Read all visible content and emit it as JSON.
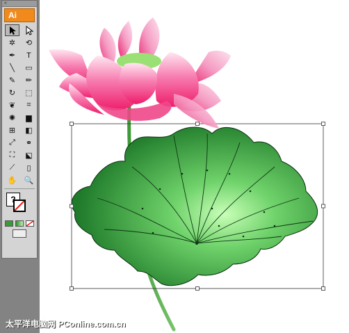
{
  "toolbox": {
    "grip": "«",
    "logo": "Ai",
    "tools": [
      {
        "name": "selection-tool",
        "glyph": "selection"
      },
      {
        "name": "direct-selection-tool",
        "glyph": "direct"
      },
      {
        "name": "magic-wand-tool",
        "glyph": "✲"
      },
      {
        "name": "lasso-tool",
        "glyph": "⟲"
      },
      {
        "name": "pen-tool",
        "glyph": "✒"
      },
      {
        "name": "type-tool",
        "glyph": "T"
      },
      {
        "name": "line-segment-tool",
        "glyph": "╲"
      },
      {
        "name": "rectangle-tool",
        "glyph": "▭"
      },
      {
        "name": "paintbrush-tool",
        "glyph": "✎"
      },
      {
        "name": "pencil-tool",
        "glyph": "✏"
      },
      {
        "name": "rotate-tool",
        "glyph": "↻"
      },
      {
        "name": "scale-tool",
        "glyph": "⬚"
      },
      {
        "name": "warp-tool",
        "glyph": "❦"
      },
      {
        "name": "free-transform-tool",
        "glyph": "⌗"
      },
      {
        "name": "symbol-sprayer-tool",
        "glyph": "✺"
      },
      {
        "name": "column-graph-tool",
        "glyph": "▆"
      },
      {
        "name": "mesh-tool",
        "glyph": "⊞"
      },
      {
        "name": "gradient-tool",
        "glyph": "◧"
      },
      {
        "name": "eyedropper-tool",
        "glyph": "⤢"
      },
      {
        "name": "blend-tool",
        "glyph": "⚭"
      },
      {
        "name": "live-paint-bucket-tool",
        "glyph": "⛶"
      },
      {
        "name": "live-paint-selection-tool",
        "glyph": "⬕"
      },
      {
        "name": "slice-tool",
        "glyph": "⟋"
      },
      {
        "name": "eraser-tool",
        "glyph": "▯"
      },
      {
        "name": "hand-tool",
        "glyph": "✋"
      },
      {
        "name": "zoom-tool",
        "glyph": "🔍"
      }
    ],
    "fill_label": "?",
    "colors": {
      "toolbox_bg": "#d4d4d4",
      "logo_bg": "#f08a1c"
    }
  },
  "watermark": "太平洋电脑网 PConline.com.cn"
}
